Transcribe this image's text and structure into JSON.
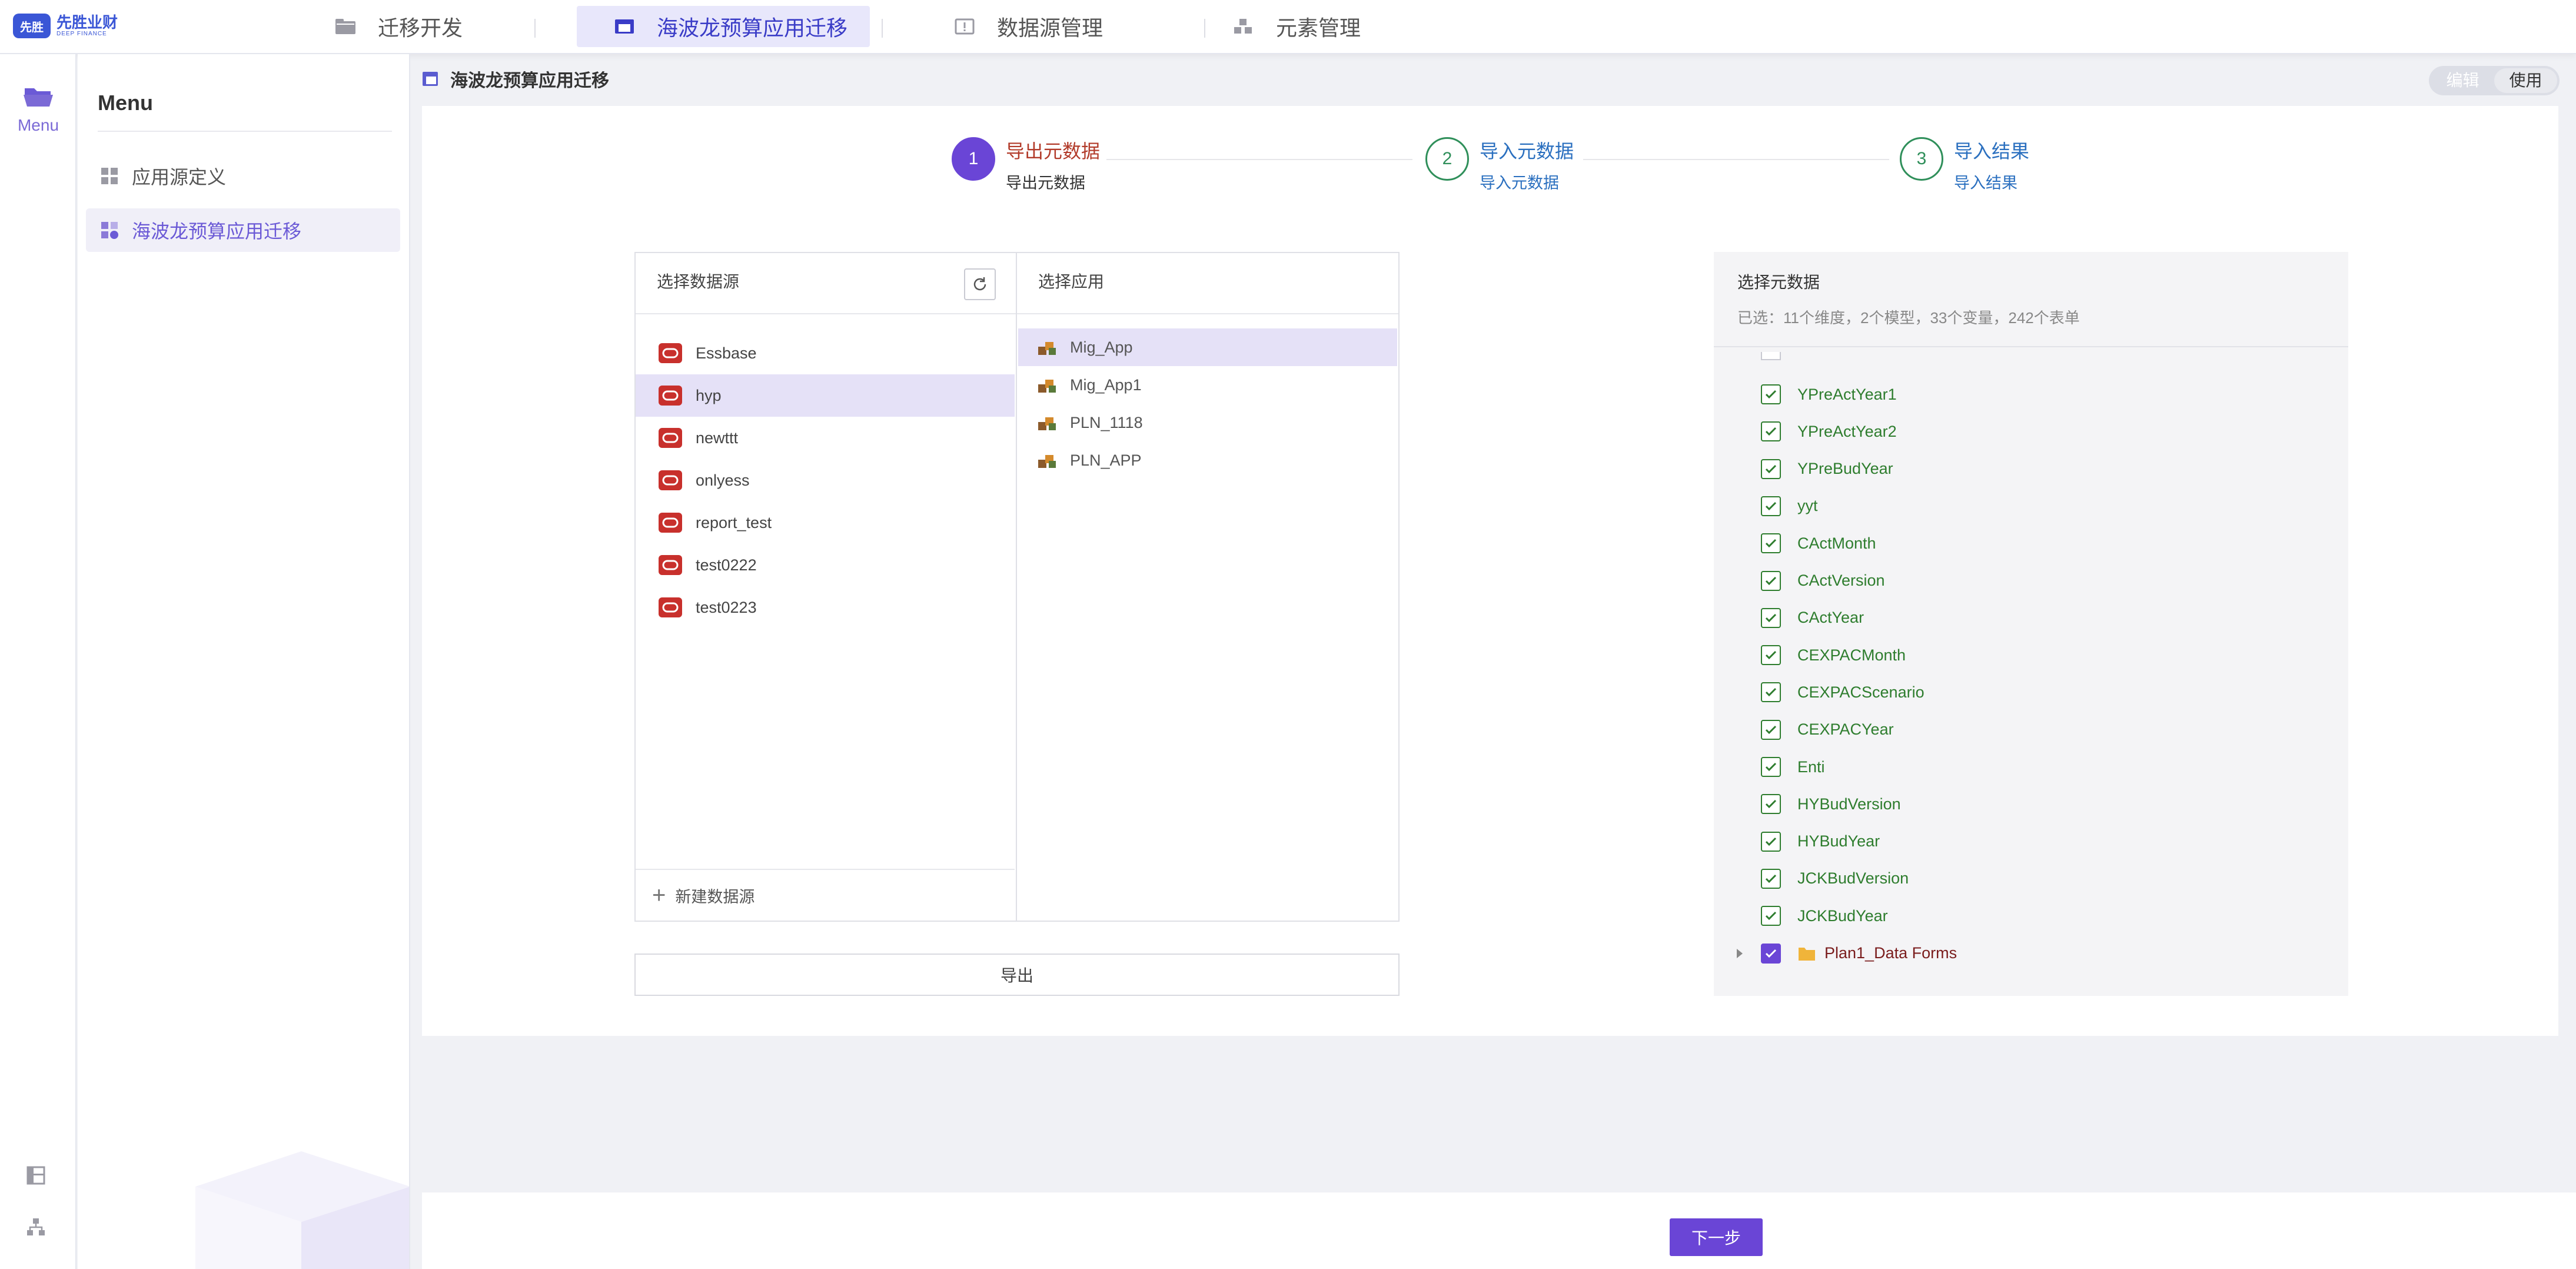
{
  "logo": {
    "badge": "先胜",
    "name": "先胜业财",
    "tagline": "DEEP FINANCE"
  },
  "nav": {
    "tabs": [
      {
        "label": "迁移开发",
        "icon": "folder-icon"
      },
      {
        "label": "海波龙预算应用迁移",
        "icon": "window-icon",
        "active": true
      },
      {
        "label": "数据源管理",
        "icon": "alert-box-icon"
      },
      {
        "label": "元素管理",
        "icon": "blocks-icon"
      }
    ]
  },
  "rail": {
    "menu_label": "Menu"
  },
  "menu": {
    "title": "Menu",
    "items": [
      {
        "label": "应用源定义",
        "icon": "grid-icon"
      },
      {
        "label": "海波龙预算应用迁移",
        "icon": "migrate-icon",
        "active": true
      }
    ]
  },
  "content": {
    "title": "海波龙预算应用迁移",
    "toggle": {
      "edit": "编辑",
      "use": "使用",
      "active": "使用"
    }
  },
  "steps": [
    {
      "num": "1",
      "title": "导出元数据",
      "sub": "导出元数据",
      "active": true
    },
    {
      "num": "2",
      "title": "导入元数据",
      "sub": "导入元数据"
    },
    {
      "num": "3",
      "title": "导入结果",
      "sub": "导入结果"
    }
  ],
  "datasource": {
    "header": "选择数据源",
    "items": [
      "Essbase",
      "hyp",
      "newttt",
      "onlyess",
      "report_test",
      "test0222",
      "test0223"
    ],
    "selected": "hyp",
    "add_label": "新建数据源"
  },
  "apps": {
    "header": "选择应用",
    "items": [
      "Mig_App",
      "Mig_App1",
      "PLN_1118",
      "PLN_APP"
    ],
    "selected": "Mig_App"
  },
  "export_label": "导出",
  "metadata": {
    "title": "选择元数据",
    "summary": "已选：11个维度，2个模型，33个变量，242个表单",
    "items": [
      "YPreActYear1",
      "YPreActYear2",
      "YPreBudYear",
      "yyt",
      "CActMonth",
      "CActVersion",
      "CActYear",
      "CEXPACMonth",
      "CEXPACScenario",
      "CEXPACYear",
      "Enti",
      "HYBudVersion",
      "HYBudYear",
      "JCKBudVersion",
      "JCKBudYear"
    ],
    "folder": "Plan1_Data Forms"
  },
  "next_label": "下一步",
  "colors": {
    "accent": "#6a45d6",
    "nav_active": "#3a3cc7",
    "check_green": "#2e7d2e",
    "oracle_red": "#c8302c"
  }
}
